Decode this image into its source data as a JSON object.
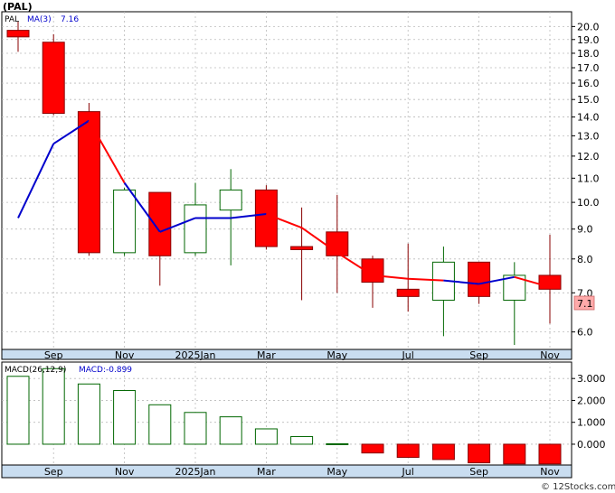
{
  "ticker_label": "(PAL)",
  "legend": {
    "symbol": "PAL",
    "ma_label": "MA(3)",
    "ma_value": "7.16",
    "macd_params": "MACD(26,12,9)",
    "macd_value": "MACD:-0.899"
  },
  "last_price_label": "7.1",
  "credit": "© 12Stocks.com",
  "colors": {
    "up": "#006600",
    "down": "#ff0000",
    "ma_below": "#0000cc",
    "ma_above": "#ff0000",
    "macd_bar": "#006600",
    "macd_neg": "#ff0000",
    "price_tag": "#ffaaaa"
  },
  "chart_data": [
    {
      "type": "candlestick",
      "title": "(PAL)",
      "y_scale": "log",
      "ylim": [
        5.6,
        21.2
      ],
      "y_ticks": [
        "20.0",
        "19.0",
        "18.0",
        "17.0",
        "16.0",
        "15.0",
        "14.0",
        "13.0",
        "12.0",
        "11.0",
        "10.0",
        "9.0",
        "8.0",
        "7.0",
        "6.0"
      ],
      "y_tick_values": [
        20,
        19,
        18,
        17,
        16,
        15,
        14,
        13,
        12,
        11,
        10,
        9,
        8,
        7,
        6
      ],
      "x_labels": [
        "Sep",
        "Nov",
        "2025Jan",
        "Mar",
        "May",
        "Jul",
        "Sep",
        "Nov"
      ],
      "x_label_positions": [
        1,
        3,
        5,
        7,
        9,
        11,
        13,
        15
      ],
      "candles": [
        {
          "open": 19.7,
          "high": 20.4,
          "low": 18.1,
          "close": 19.2
        },
        {
          "open": 18.8,
          "high": 19.4,
          "low": 14.1,
          "close": 14.2
        },
        {
          "open": 14.3,
          "high": 14.8,
          "low": 8.1,
          "close": 8.2
        },
        {
          "open": 8.2,
          "high": 10.6,
          "low": 8.1,
          "close": 10.5
        },
        {
          "open": 10.4,
          "high": 10.4,
          "low": 7.2,
          "close": 8.1
        },
        {
          "open": 8.2,
          "high": 10.8,
          "low": 8.1,
          "close": 9.9
        },
        {
          "open": 9.7,
          "high": 11.4,
          "low": 7.8,
          "close": 10.5
        },
        {
          "open": 10.5,
          "high": 10.7,
          "low": 8.3,
          "close": 8.4
        },
        {
          "open": 8.4,
          "high": 9.8,
          "low": 6.8,
          "close": 8.3
        },
        {
          "open": 8.9,
          "high": 10.3,
          "low": 7.0,
          "close": 8.1
        },
        {
          "open": 8.0,
          "high": 8.1,
          "low": 6.6,
          "close": 7.3
        },
        {
          "open": 7.1,
          "high": 8.5,
          "low": 6.5,
          "close": 6.9
        },
        {
          "open": 6.8,
          "high": 8.4,
          "low": 5.9,
          "close": 7.9
        },
        {
          "open": 7.9,
          "high": 7.9,
          "low": 6.7,
          "close": 6.9
        },
        {
          "open": 6.8,
          "high": 7.9,
          "low": 5.7,
          "close": 7.5
        },
        {
          "open": 7.5,
          "high": 8.8,
          "low": 6.2,
          "close": 7.1
        }
      ],
      "ma": [
        {
          "i": 0,
          "value": 9.4,
          "above": false
        },
        {
          "i": 1,
          "value": 12.6,
          "above": false
        },
        {
          "i": 2,
          "value": 13.8,
          "above": false
        },
        {
          "i": 3,
          "value": 10.8,
          "above": true
        },
        {
          "i": 4,
          "value": 8.9,
          "above": false
        },
        {
          "i": 5,
          "value": 9.4,
          "above": false
        },
        {
          "i": 6,
          "value": 9.4,
          "above": false
        },
        {
          "i": 7,
          "value": 9.55,
          "above": false
        },
        {
          "i": 8,
          "value": 9.05,
          "above": true
        },
        {
          "i": 9,
          "value": 8.2,
          "above": true
        },
        {
          "i": 10,
          "value": 7.5,
          "above": true
        },
        {
          "i": 11,
          "value": 7.4,
          "above": true
        },
        {
          "i": 12,
          "value": 7.35,
          "above": true
        },
        {
          "i": 13,
          "value": 7.25,
          "above": false
        },
        {
          "i": 14,
          "value": 7.45,
          "above": false
        },
        {
          "i": 15,
          "value": 7.16,
          "above": true
        }
      ]
    },
    {
      "type": "bar",
      "title": "MACD(26,12,9)",
      "ylim": [
        -0.95,
        3.75
      ],
      "y_ticks": [
        "3.000",
        "2.000",
        "1.000",
        "0.000"
      ],
      "y_tick_values": [
        3,
        2,
        1,
        0
      ],
      "values": [
        3.1,
        3.45,
        2.75,
        2.45,
        1.8,
        1.45,
        1.25,
        0.7,
        0.35,
        0.02,
        -0.4,
        -0.6,
        -0.7,
        -0.85,
        -0.9,
        -0.899
      ]
    }
  ]
}
